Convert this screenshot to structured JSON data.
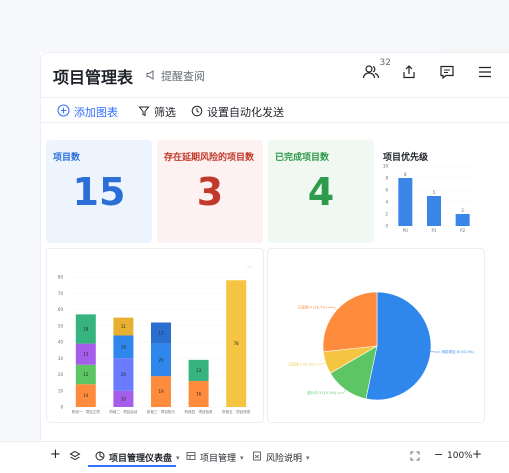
{
  "header": {
    "title": "项目管理表",
    "remind_label": "提醒查阅",
    "collaborator_count": "32"
  },
  "toolbar": {
    "add_chart": "添加图表",
    "filter": "筛选",
    "automation": "设置自动化发送"
  },
  "stats": [
    {
      "label": "项目数",
      "value": "15",
      "color": "#2b6fd6",
      "bg": "#eef4fd"
    },
    {
      "label": "存在延期风险的项目数",
      "value": "3",
      "color": "#c0392b",
      "bg": "#fdf1f1"
    },
    {
      "label": "已完成项目数",
      "value": "4",
      "color": "#2e9a4b",
      "bg": "#f1f8f2"
    }
  ],
  "priority_chart_title": "项目优先级",
  "chart_data": [
    {
      "type": "bar",
      "title": "项目优先级",
      "categories": [
        "P0",
        "P1",
        "P2"
      ],
      "values": [
        8,
        5,
        2
      ],
      "ylim": [
        0,
        10
      ],
      "yticks": [
        "0",
        "2",
        "4",
        "6",
        "8",
        "10"
      ],
      "color": "#3a86e8"
    },
    {
      "type": "bar",
      "stacked": true,
      "categories": [
        "阶段一 · 项目立项",
        "阶段二 · 项目启动",
        "阶段三 · 项目执行",
        "阶段四 · 项目验收",
        "阶段五 · 项目完成"
      ],
      "yticks": [
        "0",
        "10",
        "20",
        "30",
        "40",
        "50",
        "60",
        "70",
        "80"
      ],
      "ylim": [
        0,
        80
      ],
      "series": [
        {
          "color": "#ff8b3d",
          "values": [
            14,
            0,
            19,
            16,
            0
          ]
        },
        {
          "color": "#5dc563",
          "values": [
            12,
            0,
            0,
            0,
            0
          ]
        },
        {
          "color": "#a55eea",
          "values": [
            13,
            10,
            0,
            0,
            0
          ]
        },
        {
          "color": "#6a7bff",
          "values": [
            0,
            20,
            0,
            0,
            0
          ]
        },
        {
          "color": "#2f86eb",
          "values": [
            0,
            14,
            20,
            0,
            0
          ]
        },
        {
          "color": "#8d9cff",
          "values": [
            0,
            0,
            0,
            0,
            0
          ]
        },
        {
          "color": "#36b37e",
          "values": [
            18,
            0,
            0,
            13,
            0
          ]
        },
        {
          "color": "#e8b030",
          "values": [
            0,
            11,
            0,
            0,
            0
          ]
        },
        {
          "color": "#2a6fd0",
          "values": [
            0,
            0,
            13,
            0,
            0
          ]
        },
        {
          "color": "#f5c542",
          "values": [
            0,
            0,
            0,
            0,
            78
          ]
        }
      ],
      "value_labels": [
        [
          "14",
          "12",
          "13",
          "",
          "",
          "",
          "18",
          "",
          "",
          ""
        ],
        [
          "",
          "",
          "10",
          "20",
          "14",
          "",
          "",
          "11",
          "",
          ""
        ],
        [
          "19",
          "",
          "",
          "",
          "20",
          "",
          "",
          "",
          "13",
          ""
        ],
        [
          "16",
          "",
          "",
          "",
          "",
          "",
          "13",
          "",
          "",
          ""
        ],
        [
          "",
          "",
          "",
          "",
          "",
          "",
          "",
          "",
          "",
          "78"
        ]
      ]
    },
    {
      "type": "pie",
      "slices": [
        {
          "label": "风险项目 8 (53.3%)",
          "value": 53.3,
          "color": "#2f86eb"
        },
        {
          "label": "进行中 3 (13.3%)",
          "value": 13.3,
          "color": "#5dc563"
        },
        {
          "label": "已完成 2 (6.7%)",
          "value": 6.7,
          "color": "#f5c542"
        },
        {
          "label": "已延期 4 (26.7%)",
          "value": 26.7,
          "color": "#ff8b3d"
        }
      ]
    }
  ],
  "bottom_bar": {
    "tabs": [
      "项目管理仪表盘",
      "项目管理",
      "风险说明"
    ],
    "zoom": "100%"
  }
}
